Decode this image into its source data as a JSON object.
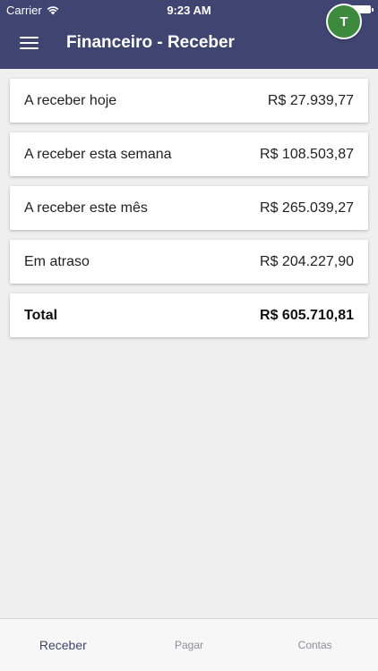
{
  "status_bar": {
    "carrier": "Carrier",
    "time": "9:23 AM"
  },
  "header": {
    "title": "Financeiro - Receber",
    "avatar_initial": "T",
    "background_color": "#3f4470",
    "avatar_color": "#3d8a3e"
  },
  "summary": [
    {
      "label": "A receber hoje",
      "value": "R$ 27.939,77"
    },
    {
      "label": "A receber esta semana",
      "value": "R$ 108.503,87"
    },
    {
      "label": "A receber este mês",
      "value": "R$ 265.039,27"
    },
    {
      "label": "Em atraso",
      "value": "R$ 204.227,90"
    }
  ],
  "total": {
    "label": "Total",
    "value": "R$ 605.710,81"
  },
  "tabs": [
    {
      "label": "Receber",
      "active": true
    },
    {
      "label": "Pagar",
      "active": false
    },
    {
      "label": "Contas",
      "active": false
    }
  ],
  "icons": {
    "menu": "menu-icon",
    "wifi": "wifi-icon",
    "battery": "battery-icon"
  }
}
